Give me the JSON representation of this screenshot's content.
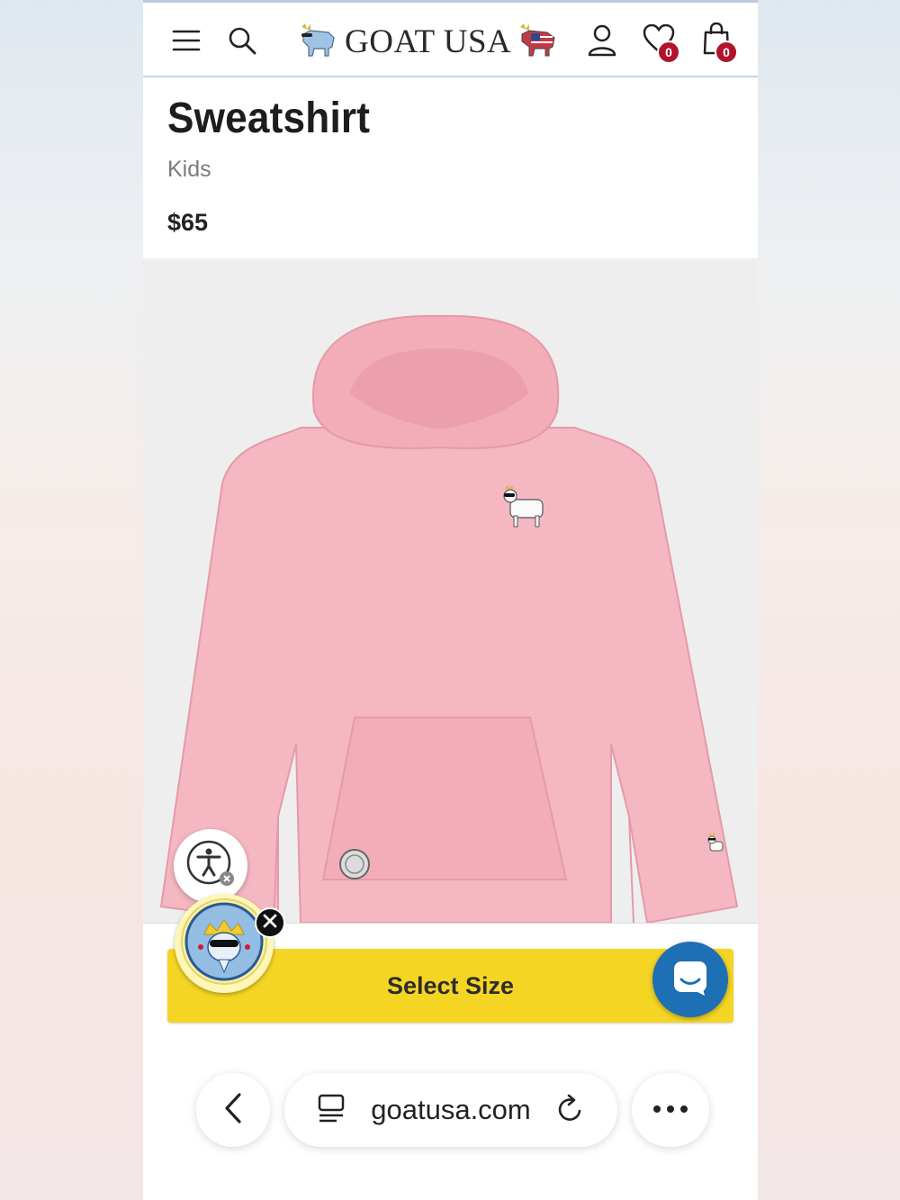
{
  "header": {
    "brand": "GOAT USA",
    "wishlist_count": "0",
    "cart_count": "0",
    "icons": [
      "menu-icon",
      "search-icon",
      "goat-logo-icon",
      "account-icon",
      "heart-icon",
      "shopping-bag-icon"
    ]
  },
  "product": {
    "title": "Sweatshirt",
    "category": "Kids",
    "price": "$65",
    "image_color": "#f5b7c2"
  },
  "actions": {
    "select_size_label": "Select Size"
  },
  "browser": {
    "url": "goatusa.com"
  },
  "colors": {
    "accent_yellow": "#f5d524",
    "badge_red": "#b1132b",
    "chat_blue": "#1e6fb3"
  }
}
